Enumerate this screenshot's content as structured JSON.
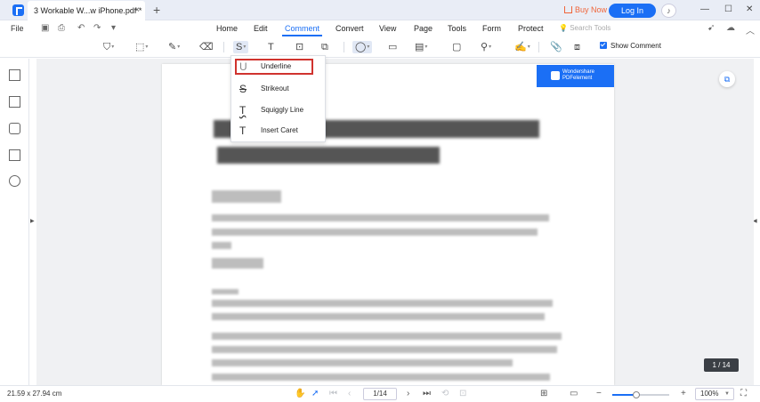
{
  "titlebar": {
    "tab_title": "3 Workable W...w iPhone.pdf *",
    "tab_close": "×",
    "new_tab": "+",
    "buy_now": "Buy Now",
    "login": "Log In",
    "window_controls": [
      "—",
      "☐",
      "✕"
    ]
  },
  "menubar": {
    "file": "File",
    "tabs": [
      "Home",
      "Edit",
      "Comment",
      "Convert",
      "View",
      "Page",
      "Tools",
      "Form",
      "Protect"
    ],
    "active_tab": "Comment",
    "search_tools": "Search Tools"
  },
  "toolbar": {
    "show_comment_label": "Show Comment",
    "show_comment_checked": true
  },
  "dropdown": {
    "items": [
      {
        "label": "Underline",
        "icon": "underline-icon",
        "glyph": "U"
      },
      {
        "label": "Strikeout",
        "icon": "strikeout-icon",
        "glyph": "S"
      },
      {
        "label": "Squiggly Line",
        "icon": "squiggly-line-icon",
        "glyph": "T"
      },
      {
        "label": "Insert Caret",
        "icon": "insert-caret-icon",
        "glyph": "T"
      }
    ],
    "highlighted": "Underline"
  },
  "document": {
    "watermark_line1": "Wondershare",
    "watermark_line2": "PDFelement"
  },
  "page_badge": "1 / 14",
  "statusbar": {
    "dimensions": "21.59 x 27.94 cm",
    "page_input": "1/14",
    "zoom": "100%",
    "zoom_level": 0.42
  },
  "colors": {
    "accent": "#1b6ff5",
    "highlight_border": "#d0332e",
    "buy_now": "#f0653a"
  }
}
